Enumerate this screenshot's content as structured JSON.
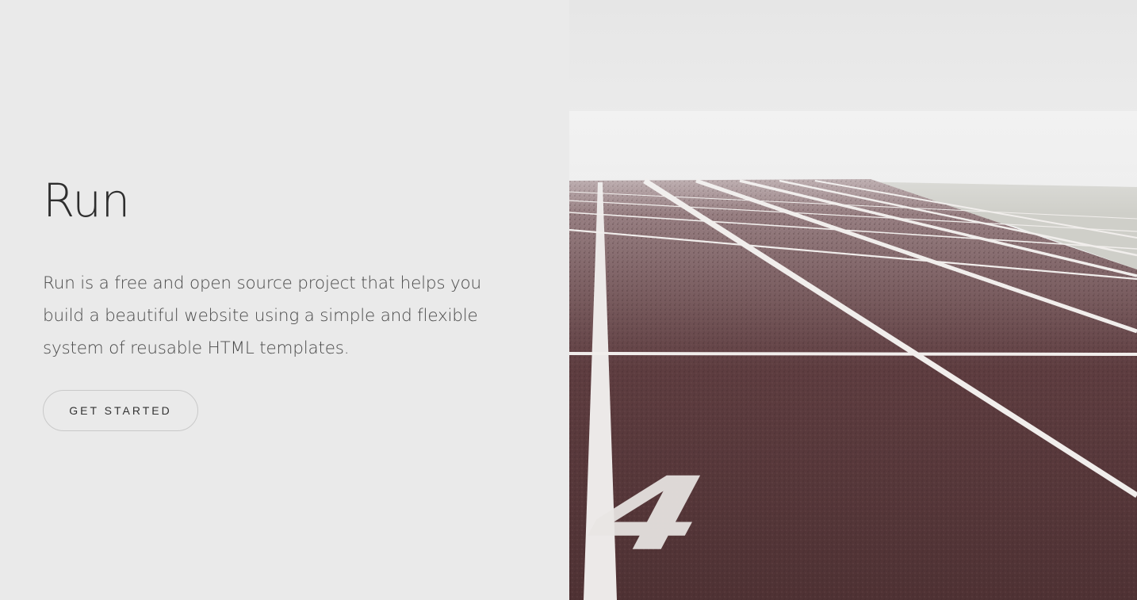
{
  "hero": {
    "title": "Run",
    "description": "Run is a free and open source project that helps you build a beautiful website using a simple and flexible system of reusable HTML templates.",
    "cta_label": "GET STARTED"
  },
  "colors": {
    "left_background": "#eaeaea",
    "track_surface": "#5a3a3c",
    "track_line": "#f2f0ee",
    "fog": "#f0f0f0"
  },
  "image": {
    "lane_number": "4"
  }
}
